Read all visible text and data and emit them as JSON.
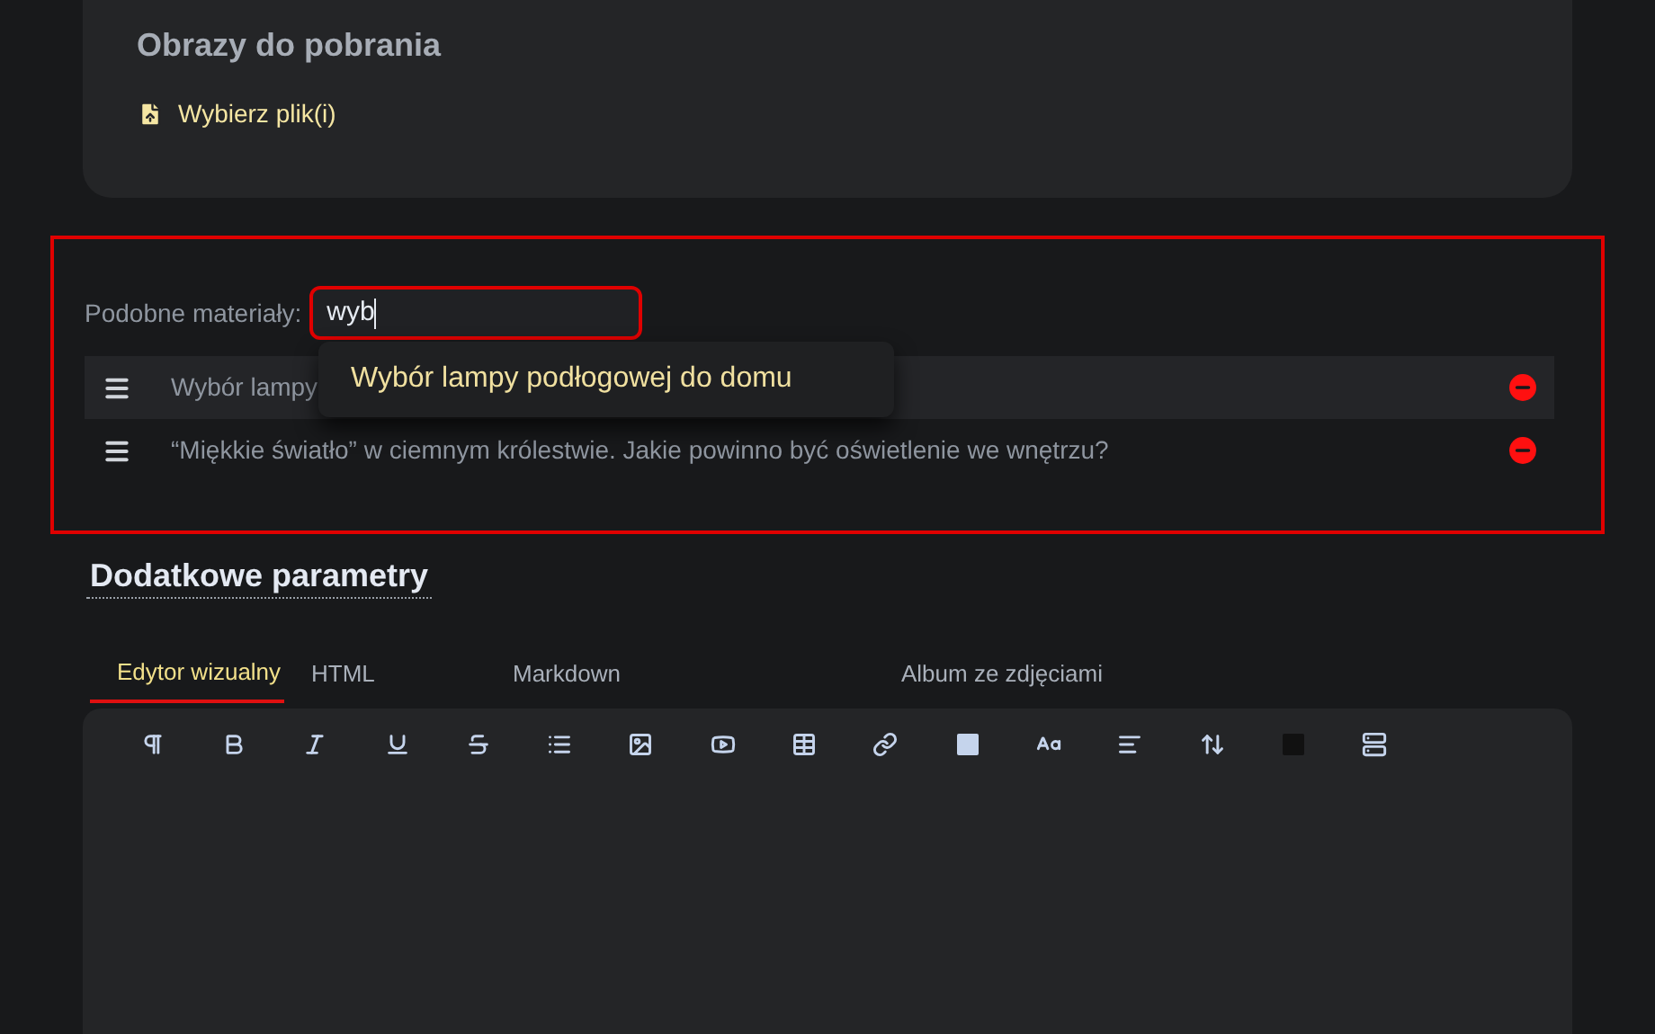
{
  "downloads": {
    "title": "Obrazy do pobrania",
    "button": "Wybierz plik(i)"
  },
  "related": {
    "label": "Podobne materiały:",
    "value": "wyb",
    "suggestion": "Wybór lampy podłogowej do domu",
    "items": [
      {
        "text": "Wybór lampy",
        "highlighted": true
      },
      {
        "text": "“Miękkie światło” w ciemnym królestwie. Jakie powinno być oświetlenie we wnętrzu?",
        "highlighted": false
      }
    ]
  },
  "parameters": {
    "title": "Dodatkowe parametry"
  },
  "tabs": [
    {
      "label": "Edytor wizualny",
      "selected": true
    },
    {
      "label": "HTML",
      "selected": false
    },
    {
      "label": "Markdown",
      "selected": false
    },
    {
      "label": "Album ze zdjęciami",
      "selected": false
    }
  ]
}
